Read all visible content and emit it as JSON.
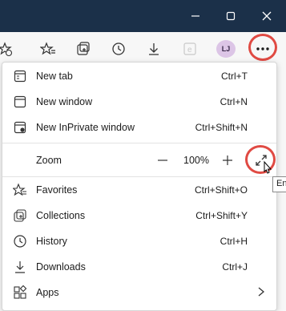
{
  "window": {
    "minimize_icon": "minimize-icon",
    "maximize_icon": "maximize-icon",
    "close_icon": "close-icon"
  },
  "toolbar": {
    "profile_initials": "LJ",
    "more_label": "···"
  },
  "menu": {
    "items_top": [
      {
        "label": "New tab",
        "shortcut": "Ctrl+T",
        "icon": "new-tab-icon"
      },
      {
        "label": "New window",
        "shortcut": "Ctrl+N",
        "icon": "new-window-icon"
      },
      {
        "label": "New InPrivate window",
        "shortcut": "Ctrl+Shift+N",
        "icon": "inprivate-icon"
      }
    ],
    "zoom": {
      "label": "Zoom",
      "minus": "—",
      "value": "100%",
      "plus": "+"
    },
    "items_bottom": [
      {
        "label": "Favorites",
        "shortcut": "Ctrl+Shift+O",
        "icon": "favorites-icon"
      },
      {
        "label": "Collections",
        "shortcut": "Ctrl+Shift+Y",
        "icon": "collections-icon"
      },
      {
        "label": "History",
        "shortcut": "Ctrl+H",
        "icon": "history-icon"
      },
      {
        "label": "Downloads",
        "shortcut": "Ctrl+J",
        "icon": "downloads-icon"
      },
      {
        "label": "Apps",
        "shortcut": "",
        "icon": "apps-icon"
      }
    ]
  },
  "tooltip": {
    "text": "En"
  },
  "colors": {
    "titlebar": "#1b3049",
    "callout": "#e04a43",
    "avatar": "#dcc5e6"
  }
}
